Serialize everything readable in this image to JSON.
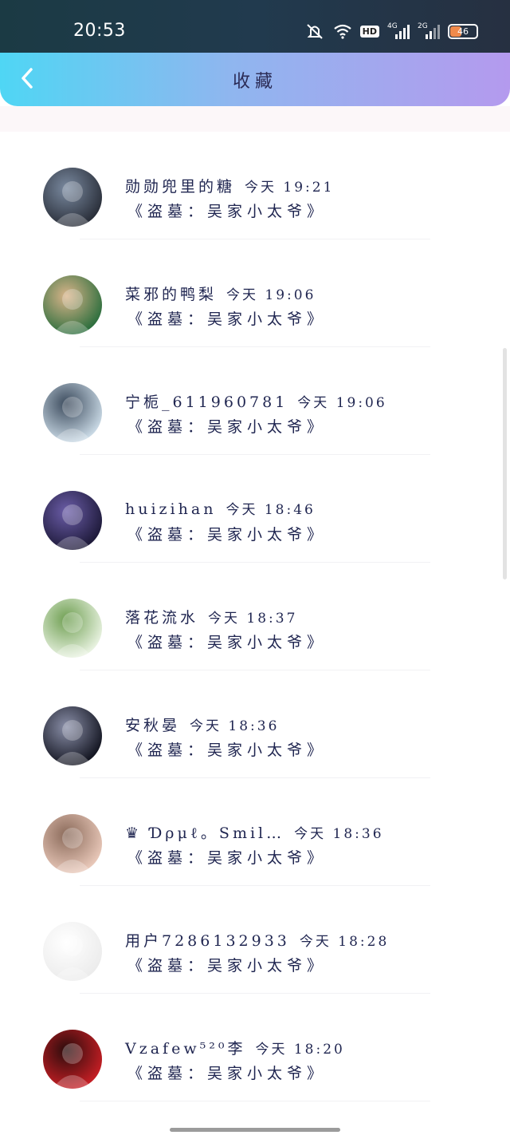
{
  "status_bar": {
    "time": "20:53",
    "hd_label": "HD",
    "net1_label": "4G",
    "net2_label": "2G",
    "battery": "46",
    "battery_color": "#f08a4b"
  },
  "header": {
    "title": "收藏",
    "back_icon": "chevron-left-icon"
  },
  "items": [
    {
      "user": "勋勋兜里的糖",
      "date": "今天 19:21",
      "book": "《盗墓：吴家小太爷》",
      "avatar_colors": [
        "#2a2f3a",
        "#7a8aa0"
      ]
    },
    {
      "user": "菜邪的鸭梨",
      "date": "今天 19:06",
      "book": "《盗墓：吴家小太爷》",
      "avatar_colors": [
        "#2e6f3e",
        "#d9b48a"
      ]
    },
    {
      "user": "宁栀_611960781",
      "date": "今天 19:06",
      "book": "《盗墓：吴家小太爷》",
      "avatar_colors": [
        "#c8d8e4",
        "#3b4a5c"
      ]
    },
    {
      "user": "huizihan",
      "date": "今天 18:46",
      "book": "《盗墓：吴家小太爷》",
      "avatar_colors": [
        "#1e1a3a",
        "#6b5da8"
      ]
    },
    {
      "user": "落花流水",
      "date": "今天 18:37",
      "book": "《盗墓：吴家小太爷》",
      "avatar_colors": [
        "#e8f2e0",
        "#6f9f52"
      ]
    },
    {
      "user": "安秋晏",
      "date": "今天 18:36",
      "book": "《盗墓：吴家小太爷》",
      "avatar_colors": [
        "#141622",
        "#8a8fa8"
      ]
    },
    {
      "user": "♛ Ɗρμℓ。Smil…",
      "date": "今天 18:36",
      "book": "《盗墓：吴家小太爷》",
      "avatar_colors": [
        "#e8c7b8",
        "#8a6a5a"
      ]
    },
    {
      "user": "用户7286132933",
      "date": "今天 18:28",
      "book": "《盗墓：吴家小太爷》",
      "avatar_colors": [
        "#ececec",
        "#ffffff"
      ]
    },
    {
      "user": "Vzafew⁵²⁰李",
      "date": "今天 18:20",
      "book": "《盗墓：吴家小太爷》",
      "avatar_colors": [
        "#c41e24",
        "#2a0c0c"
      ]
    }
  ]
}
